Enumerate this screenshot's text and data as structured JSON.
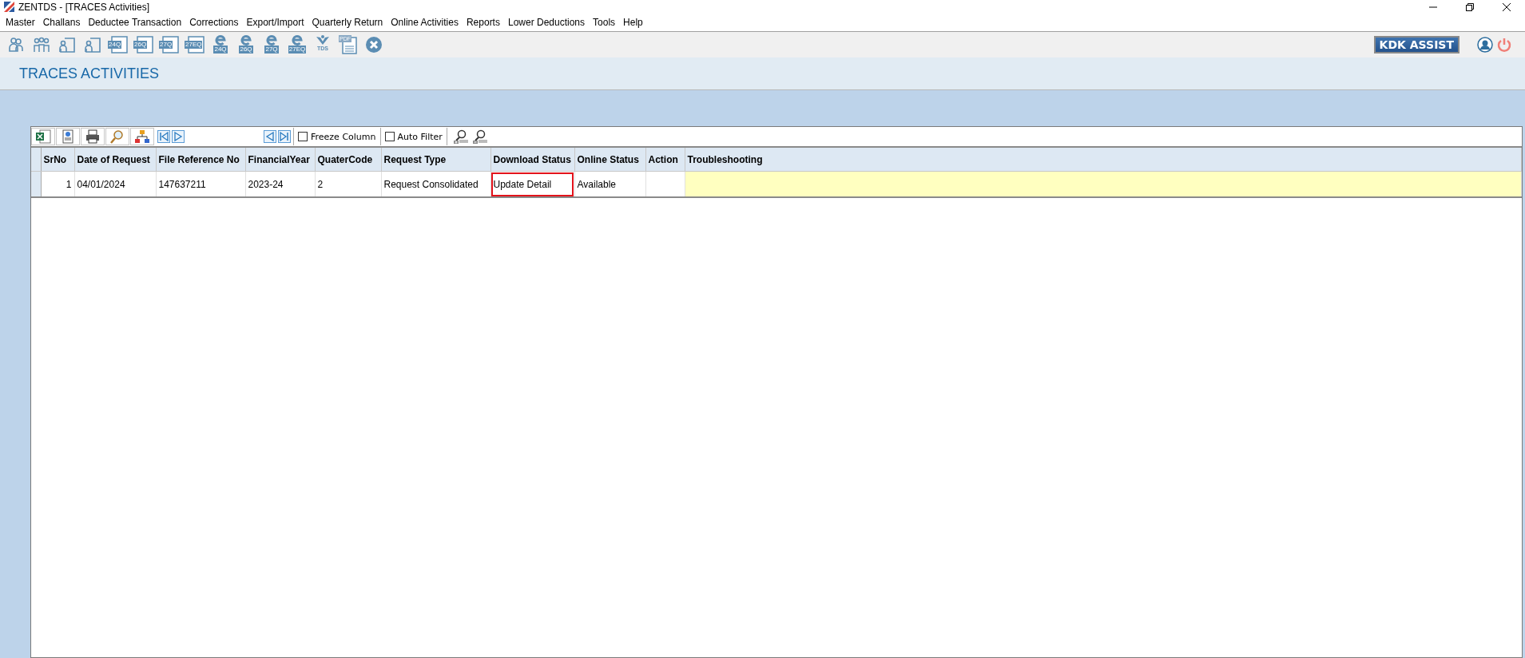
{
  "window": {
    "title": "ZENTDS - [TRACES Activities]"
  },
  "menu": [
    "Master",
    "Challans",
    "Deductee Transaction",
    "Corrections",
    "Export/Import",
    "Quarterly Return",
    "Online Activities",
    "Reports",
    "Lower Deductions",
    "Tools",
    "Help"
  ],
  "toolbar": [
    {
      "kind": "people"
    },
    {
      "kind": "group"
    },
    {
      "kind": "user-card"
    },
    {
      "kind": "user-card"
    },
    {
      "kind": "form",
      "label": "24Q"
    },
    {
      "kind": "form",
      "label": "26Q"
    },
    {
      "kind": "form",
      "label": "27Q"
    },
    {
      "kind": "form",
      "label": "27EQ"
    },
    {
      "kind": "eform",
      "label": "24Q"
    },
    {
      "kind": "eform",
      "label": "26Q"
    },
    {
      "kind": "eform",
      "label": "27Q"
    },
    {
      "kind": "eform",
      "label": "27EQ"
    },
    {
      "kind": "tds",
      "label": "TDS"
    },
    {
      "kind": "pdf",
      "label": "PDF"
    },
    {
      "kind": "close"
    }
  ],
  "assist_button": "KDK ASSIST",
  "page_title": "TRACES ACTIVITIES",
  "grid_toolbar": {
    "tools": [
      {
        "kind": "excel"
      },
      {
        "kind": "document"
      },
      {
        "kind": "print"
      },
      {
        "kind": "find"
      },
      {
        "kind": "tree"
      }
    ],
    "nav_start": [
      {
        "kind": "first"
      },
      {
        "kind": "next"
      }
    ],
    "nav_end": [
      {
        "kind": "previous"
      },
      {
        "kind": "last"
      }
    ],
    "checkboxes": [
      {
        "label": "Freeze Column",
        "checked": false
      },
      {
        "label": "Auto Filter",
        "checked": false
      }
    ],
    "zoom": [
      {
        "kind": "zoom-in"
      },
      {
        "kind": "zoom-out"
      }
    ]
  },
  "table": {
    "columns": [
      "SrNo",
      "Date of Request",
      "File Reference No",
      "FinancialYear",
      "QuaterCode",
      "Request Type",
      "Download Status",
      "Online Status",
      "Action",
      "Troubleshooting"
    ],
    "rows": [
      {
        "cells": [
          {
            "text": "1",
            "highlighted": false
          },
          {
            "text": "04/01/2024",
            "highlighted": false
          },
          {
            "text": "147637211",
            "highlighted": false
          },
          {
            "text": "2023-24",
            "highlighted": false
          },
          {
            "text": "2",
            "highlighted": false
          },
          {
            "text": "Request Consolidated",
            "highlighted": false
          },
          {
            "text": "Update Detail",
            "highlighted": true
          },
          {
            "text": "Available",
            "highlighted": false
          }
        ]
      }
    ]
  }
}
